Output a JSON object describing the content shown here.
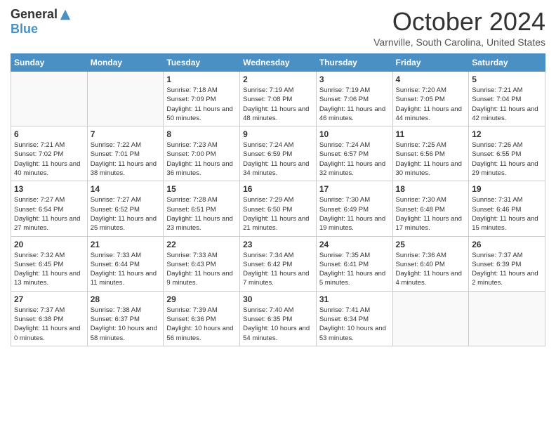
{
  "header": {
    "logo_general": "General",
    "logo_blue": "Blue",
    "month_title": "October 2024",
    "location": "Varnville, South Carolina, United States"
  },
  "days_of_week": [
    "Sunday",
    "Monday",
    "Tuesday",
    "Wednesday",
    "Thursday",
    "Friday",
    "Saturday"
  ],
  "weeks": [
    [
      {
        "num": "",
        "empty": true
      },
      {
        "num": "",
        "empty": true
      },
      {
        "num": "1",
        "sunrise": "7:18 AM",
        "sunset": "7:09 PM",
        "daylight": "11 hours and 50 minutes."
      },
      {
        "num": "2",
        "sunrise": "7:19 AM",
        "sunset": "7:08 PM",
        "daylight": "11 hours and 48 minutes."
      },
      {
        "num": "3",
        "sunrise": "7:19 AM",
        "sunset": "7:06 PM",
        "daylight": "11 hours and 46 minutes."
      },
      {
        "num": "4",
        "sunrise": "7:20 AM",
        "sunset": "7:05 PM",
        "daylight": "11 hours and 44 minutes."
      },
      {
        "num": "5",
        "sunrise": "7:21 AM",
        "sunset": "7:04 PM",
        "daylight": "11 hours and 42 minutes."
      }
    ],
    [
      {
        "num": "6",
        "sunrise": "7:21 AM",
        "sunset": "7:02 PM",
        "daylight": "11 hours and 40 minutes."
      },
      {
        "num": "7",
        "sunrise": "7:22 AM",
        "sunset": "7:01 PM",
        "daylight": "11 hours and 38 minutes."
      },
      {
        "num": "8",
        "sunrise": "7:23 AM",
        "sunset": "7:00 PM",
        "daylight": "11 hours and 36 minutes."
      },
      {
        "num": "9",
        "sunrise": "7:24 AM",
        "sunset": "6:59 PM",
        "daylight": "11 hours and 34 minutes."
      },
      {
        "num": "10",
        "sunrise": "7:24 AM",
        "sunset": "6:57 PM",
        "daylight": "11 hours and 32 minutes."
      },
      {
        "num": "11",
        "sunrise": "7:25 AM",
        "sunset": "6:56 PM",
        "daylight": "11 hours and 30 minutes."
      },
      {
        "num": "12",
        "sunrise": "7:26 AM",
        "sunset": "6:55 PM",
        "daylight": "11 hours and 29 minutes."
      }
    ],
    [
      {
        "num": "13",
        "sunrise": "7:27 AM",
        "sunset": "6:54 PM",
        "daylight": "11 hours and 27 minutes."
      },
      {
        "num": "14",
        "sunrise": "7:27 AM",
        "sunset": "6:52 PM",
        "daylight": "11 hours and 25 minutes."
      },
      {
        "num": "15",
        "sunrise": "7:28 AM",
        "sunset": "6:51 PM",
        "daylight": "11 hours and 23 minutes."
      },
      {
        "num": "16",
        "sunrise": "7:29 AM",
        "sunset": "6:50 PM",
        "daylight": "11 hours and 21 minutes."
      },
      {
        "num": "17",
        "sunrise": "7:30 AM",
        "sunset": "6:49 PM",
        "daylight": "11 hours and 19 minutes."
      },
      {
        "num": "18",
        "sunrise": "7:30 AM",
        "sunset": "6:48 PM",
        "daylight": "11 hours and 17 minutes."
      },
      {
        "num": "19",
        "sunrise": "7:31 AM",
        "sunset": "6:46 PM",
        "daylight": "11 hours and 15 minutes."
      }
    ],
    [
      {
        "num": "20",
        "sunrise": "7:32 AM",
        "sunset": "6:45 PM",
        "daylight": "11 hours and 13 minutes."
      },
      {
        "num": "21",
        "sunrise": "7:33 AM",
        "sunset": "6:44 PM",
        "daylight": "11 hours and 11 minutes."
      },
      {
        "num": "22",
        "sunrise": "7:33 AM",
        "sunset": "6:43 PM",
        "daylight": "11 hours and 9 minutes."
      },
      {
        "num": "23",
        "sunrise": "7:34 AM",
        "sunset": "6:42 PM",
        "daylight": "11 hours and 7 minutes."
      },
      {
        "num": "24",
        "sunrise": "7:35 AM",
        "sunset": "6:41 PM",
        "daylight": "11 hours and 5 minutes."
      },
      {
        "num": "25",
        "sunrise": "7:36 AM",
        "sunset": "6:40 PM",
        "daylight": "11 hours and 4 minutes."
      },
      {
        "num": "26",
        "sunrise": "7:37 AM",
        "sunset": "6:39 PM",
        "daylight": "11 hours and 2 minutes."
      }
    ],
    [
      {
        "num": "27",
        "sunrise": "7:37 AM",
        "sunset": "6:38 PM",
        "daylight": "11 hours and 0 minutes."
      },
      {
        "num": "28",
        "sunrise": "7:38 AM",
        "sunset": "6:37 PM",
        "daylight": "10 hours and 58 minutes."
      },
      {
        "num": "29",
        "sunrise": "7:39 AM",
        "sunset": "6:36 PM",
        "daylight": "10 hours and 56 minutes."
      },
      {
        "num": "30",
        "sunrise": "7:40 AM",
        "sunset": "6:35 PM",
        "daylight": "10 hours and 54 minutes."
      },
      {
        "num": "31",
        "sunrise": "7:41 AM",
        "sunset": "6:34 PM",
        "daylight": "10 hours and 53 minutes."
      },
      {
        "num": "",
        "empty": true
      },
      {
        "num": "",
        "empty": true
      }
    ]
  ]
}
